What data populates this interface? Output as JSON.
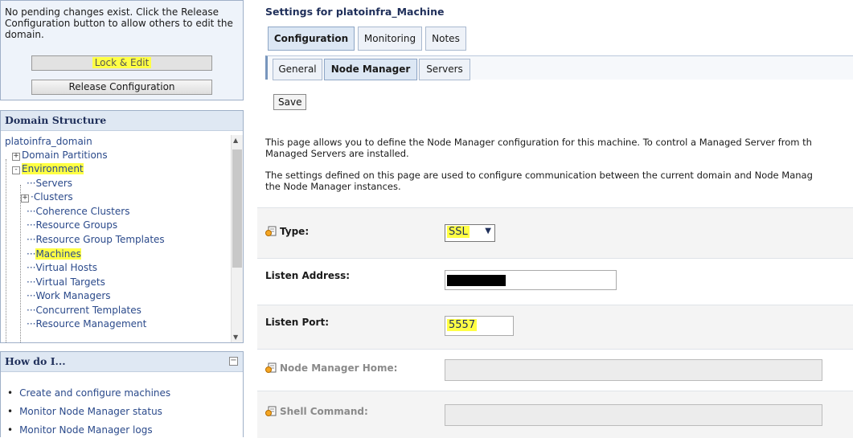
{
  "change_center": {
    "message": "No pending changes exist. Click the Release Configuration button to allow others to edit the domain.",
    "lock_edit_label": "Lock & Edit",
    "release_label": "Release Configuration"
  },
  "domain_structure": {
    "title": "Domain Structure",
    "items": [
      {
        "label": "platoinfra_domain"
      },
      {
        "label": "Domain Partitions",
        "expander": "+"
      },
      {
        "label": "Environment",
        "expander": "-"
      },
      {
        "label": "Servers"
      },
      {
        "label": "Clusters",
        "expander": "+"
      },
      {
        "label": "Coherence Clusters"
      },
      {
        "label": "Resource Groups"
      },
      {
        "label": "Resource Group Templates"
      },
      {
        "label": "Machines"
      },
      {
        "label": "Virtual Hosts"
      },
      {
        "label": "Virtual Targets"
      },
      {
        "label": "Work Managers"
      },
      {
        "label": "Concurrent Templates"
      },
      {
        "label": "Resource Management"
      }
    ]
  },
  "how_do_i": {
    "title": "How do I...",
    "toggle": "−",
    "links": [
      "Create and configure machines",
      "Monitor Node Manager status",
      "Monitor Node Manager logs"
    ]
  },
  "settings": {
    "title": "Settings for platoinfra_Machine",
    "tabs": [
      "Configuration",
      "Monitoring",
      "Notes"
    ],
    "subtabs": [
      "General",
      "Node Manager",
      "Servers"
    ],
    "save_label": "Save",
    "desc1_line1": "This page allows you to define the Node Manager configuration for this machine. To control a Managed Server from th",
    "desc1_line2": "Managed Servers are installed.",
    "desc2_line1": "The settings defined on this page are used to configure communication between the current domain and Node Manag",
    "desc2_line2": "the Node Manager instances."
  },
  "form": {
    "type_label": "Type:",
    "type_value": "SSL",
    "listen_address_label": "Listen Address:",
    "listen_port_label": "Listen Port:",
    "listen_port_value": "5557",
    "nm_home_label": "Node Manager Home:",
    "shell_command_label": "Shell Command:"
  },
  "colors": {
    "highlight": "#ffff44",
    "link": "#2b4a8b",
    "panel_header": "#dfe8f3"
  }
}
